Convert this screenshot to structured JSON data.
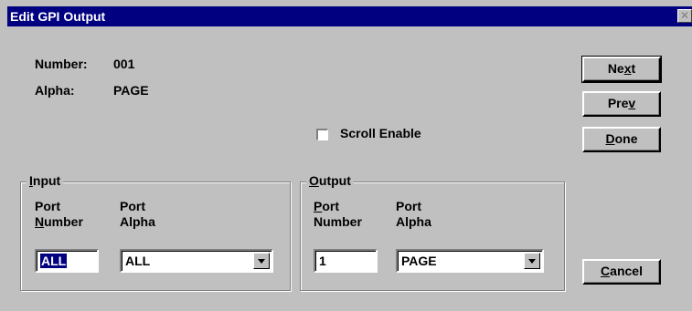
{
  "window": {
    "title": "Edit GPI Output",
    "close_glyph": "✕"
  },
  "info": {
    "number_label": "Number:",
    "number_value": "001",
    "alpha_label": "Alpha:",
    "alpha_value": "PAGE"
  },
  "scroll": {
    "label": "Scroll Enable",
    "checked": false
  },
  "buttons": {
    "next": {
      "pre": "Ne",
      "key": "x",
      "post": "t"
    },
    "prev": {
      "pre": "Pre",
      "key": "v",
      "post": ""
    },
    "done": {
      "pre": "",
      "key": "D",
      "post": "one"
    },
    "cancel": {
      "pre": "",
      "key": "C",
      "post": "ancel"
    }
  },
  "input_group": {
    "title_key": "I",
    "title_rest": "nput",
    "port_number_l1": "Port",
    "port_number_key": "N",
    "port_number_rest": "umber",
    "port_alpha_l1": "Port",
    "port_alpha_l2": "Alpha",
    "port_number_value": "ALL",
    "port_alpha_value": "ALL"
  },
  "output_group": {
    "title_key": "O",
    "title_rest": "utput",
    "port_l1_key": "P",
    "port_l1_rest": "ort",
    "port_number_l2": "Number",
    "port_alpha_l1": "Port",
    "port_alpha_l2": "Alpha",
    "port_number_value": "1",
    "port_alpha_value": "PAGE"
  }
}
